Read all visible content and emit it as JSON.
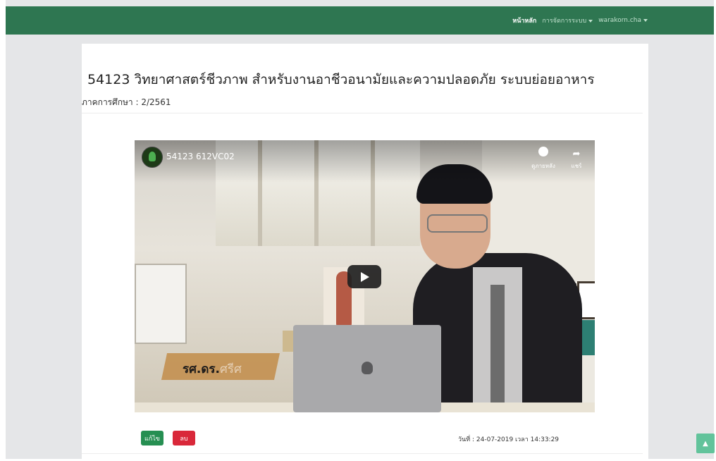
{
  "nav": {
    "home": "หน้าหลัก",
    "manage": "การจัดการระบบ",
    "user": "warakorn.cha"
  },
  "course": {
    "title": "54123 วิทยาศาสตร์ชีวภาพ สำหรับงานอาชีวอนามัยและความปลอดภัย ระบบย่อยอาหาร",
    "semester": "ภาคการศึกษา : 2/2561"
  },
  "video": {
    "title": "54123 612VC02",
    "watch_later": "ดูภายหลัง",
    "share": "แชร์",
    "name_overlay": "รศ.ดร.",
    "name_overlay_faded": "ศรีศ"
  },
  "actions": {
    "edit": "แก้ไข",
    "delete": "ลบ"
  },
  "meta": {
    "timestamp": "วันที่ : 24-07-2019 เวลา 14:33:29"
  },
  "colors": {
    "navbar": "#2e7651",
    "edit": "#268f52",
    "delete": "#d9283a",
    "scroll_top": "#62c39b"
  }
}
